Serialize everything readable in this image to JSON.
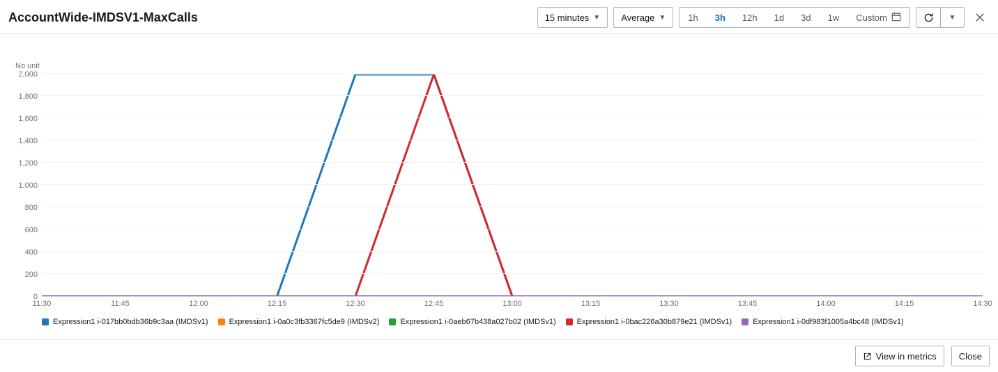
{
  "header": {
    "title": "AccountWide-IMDSV1-MaxCalls",
    "period_label": "15 minutes",
    "stat_label": "Average",
    "ranges": [
      {
        "label": "1h",
        "active": false
      },
      {
        "label": "3h",
        "active": true
      },
      {
        "label": "12h",
        "active": false
      },
      {
        "label": "1d",
        "active": false
      },
      {
        "label": "3d",
        "active": false
      },
      {
        "label": "1w",
        "active": false
      }
    ],
    "custom_label": "Custom"
  },
  "footer": {
    "view_label": "View in metrics",
    "close_label": "Close"
  },
  "chart": {
    "no_unit": "No unit",
    "y_ticks": [
      "0",
      "200",
      "400",
      "600",
      "800",
      "1,000",
      "1,200",
      "1,400",
      "1,600",
      "1,800",
      "2,000"
    ],
    "x_ticks": [
      "11:30",
      "11:45",
      "12:00",
      "12:15",
      "12:30",
      "12:45",
      "13:00",
      "13:15",
      "13:30",
      "13:45",
      "14:00",
      "14:15",
      "14:30"
    ],
    "legend": [
      {
        "label": "Expression1 i-017bb0bdb36b9c3aa (IMDSv1)",
        "color": "#1f77b4"
      },
      {
        "label": "Expression1 i-0a0c3fb3367fc5de9 (IMDSv2)",
        "color": "#ff7f0e"
      },
      {
        "label": "Expression1 i-0aeb67b438a027b02 (IMDSv1)",
        "color": "#2ca02c"
      },
      {
        "label": "Expression1 i-0bac226a30b879e21 (IMDSv1)",
        "color": "#d62728"
      },
      {
        "label": "Expression1 i-0df983f1005a4bc48 (IMDSv1)",
        "color": "#9467bd"
      }
    ]
  },
  "chart_data": {
    "type": "line",
    "title": "AccountWide-IMDSV1-MaxCalls",
    "xlabel": "",
    "ylabel": "No unit",
    "ylim": [
      0,
      2000
    ],
    "x": [
      "11:30",
      "11:45",
      "12:00",
      "12:15",
      "12:30",
      "12:45",
      "13:00",
      "13:15",
      "13:30",
      "13:45",
      "14:00",
      "14:15",
      "14:30"
    ],
    "series": [
      {
        "name": "Expression1 i-017bb0bdb36b9c3aa (IMDSv1)",
        "color": "#1f77b4",
        "values": [
          0,
          0,
          0,
          0,
          2000,
          2000,
          0,
          0,
          0,
          0,
          0,
          0,
          0
        ]
      },
      {
        "name": "Expression1 i-0a0c3fb3367fc5de9 (IMDSv2)",
        "color": "#ff7f0e",
        "values": [
          0,
          0,
          0,
          0,
          0,
          0,
          0,
          0,
          0,
          0,
          0,
          0,
          0
        ]
      },
      {
        "name": "Expression1 i-0aeb67b438a027b02 (IMDSv1)",
        "color": "#2ca02c",
        "values": [
          0,
          0,
          0,
          0,
          0,
          0,
          0,
          0,
          0,
          0,
          0,
          0,
          0
        ]
      },
      {
        "name": "Expression1 i-0bac226a30b879e21 (IMDSv1)",
        "color": "#d62728",
        "values": [
          0,
          0,
          0,
          0,
          0,
          2000,
          0,
          0,
          0,
          0,
          0,
          0,
          0
        ]
      },
      {
        "name": "Expression1 i-0df983f1005a4bc48 (IMDSv1)",
        "color": "#9467bd",
        "values": [
          0,
          0,
          0,
          0,
          0,
          0,
          0,
          0,
          0,
          0,
          0,
          0,
          0
        ]
      }
    ]
  }
}
